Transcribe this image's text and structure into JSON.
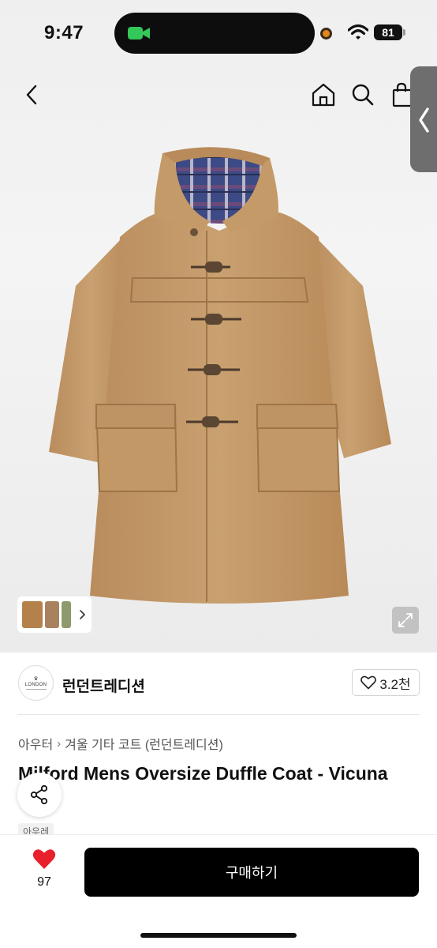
{
  "status_bar": {
    "time": "9:47",
    "battery": "81",
    "icons": [
      "facetime-camera-icon",
      "recording-dot-icon",
      "wifi-icon",
      "battery-icon"
    ]
  },
  "nav": {
    "icons": [
      "chevron-left-icon",
      "home-icon",
      "search-icon",
      "shopping-bag-icon",
      "side-panel-chevron-icon"
    ]
  },
  "gallery": {
    "thumb_colors": [
      "#b5814a",
      "#a8825e",
      "#8f9a6c"
    ],
    "icons": [
      "chevron-right-icon",
      "expand-icon"
    ]
  },
  "seller": {
    "logo_text": "LONDON",
    "name": "런던트레디션",
    "likes": "3.2천",
    "icons": [
      "heart-outline-icon"
    ]
  },
  "product": {
    "breadcrumb": [
      "아우터",
      "겨울 기타 코트 (런던트레디션)"
    ],
    "title": "Milford Mens Oversize Duffle Coat - Vicuna",
    "tag": "아우레",
    "icons": [
      "share-icon"
    ]
  },
  "bottom_bar": {
    "wish_count": "97",
    "buy_label": "구매하기",
    "icons": [
      "heart-filled-icon"
    ]
  },
  "colors": {
    "coat": "#c59a6a",
    "accent_heart": "#e8202b",
    "buy_button": "#000000"
  }
}
